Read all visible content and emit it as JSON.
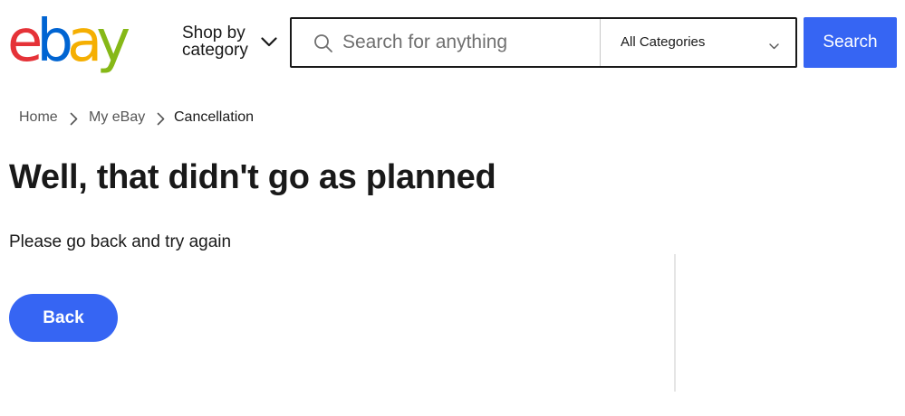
{
  "header": {
    "logo": {
      "letters": [
        {
          "char": "e",
          "color": "#e53238"
        },
        {
          "char": "b",
          "color": "#0064d2"
        },
        {
          "char": "a",
          "color": "#f5af02"
        },
        {
          "char": "y",
          "color": "#86b817"
        }
      ],
      "icon": "ebay-logo"
    },
    "shop_by_category": {
      "line1": "Shop by",
      "line2": "category",
      "icon": "chevron-down-icon"
    },
    "search": {
      "placeholder": "Search for anything",
      "value": "",
      "icon": "search-icon",
      "category_selected": "All Categories",
      "category_icon": "chevron-down-icon",
      "button_label": "Search"
    }
  },
  "breadcrumb": {
    "items": [
      "Home",
      "My eBay",
      "Cancellation"
    ],
    "separator_icon": "chevron-right-icon"
  },
  "main": {
    "title": "Well, that didn't go as planned",
    "message": "Please go back and try again",
    "back_button_label": "Back"
  },
  "colors": {
    "accent": "#3665f3",
    "text": "#191919",
    "muted_text": "#555555",
    "border": "#191919",
    "divider": "#e5e5e5"
  }
}
